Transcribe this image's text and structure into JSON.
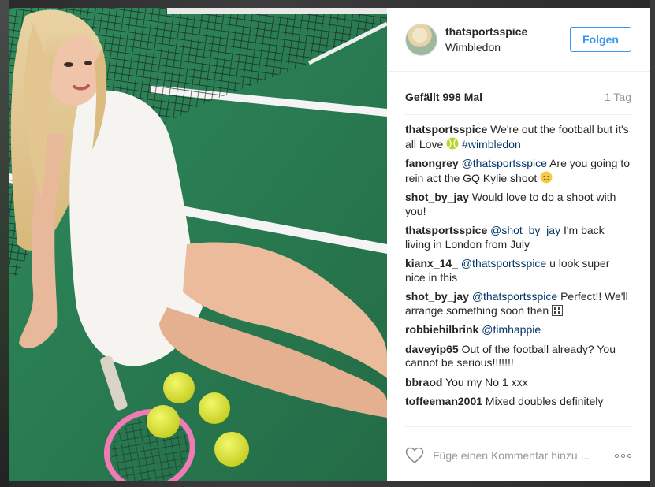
{
  "post": {
    "username": "thatsportsspice",
    "location": "Wimbledon",
    "follow_label": "Folgen",
    "likes": "Gefällt 998 Mal",
    "time": "1 Tag",
    "comment_placeholder": "Füge einen Kommentar hinzu ..."
  },
  "comments": [
    {
      "author": "thatsportsspice",
      "before": " We're out the football but it's all Love ",
      "emoji": "tennis-ball",
      "mention": "",
      "hashtag": "#wimbledon",
      "after": ""
    },
    {
      "author": "fanongrey",
      "before": " ",
      "mention": "@thatsportsspice",
      "after": " Are you going to rein act the GQ Kylie shoot ",
      "emoji_end": "smile"
    },
    {
      "author": "shot_by_jay",
      "before": " Would love to do a shoot with you!",
      "mention": "",
      "after": ""
    },
    {
      "author": "thatsportsspice",
      "before": " ",
      "mention": "@shot_by_jay",
      "after": " I'm back living in London from July"
    },
    {
      "author": "kianx_14_",
      "before": " ",
      "mention": "@thatsportsspice",
      "after": " u look super nice in this"
    },
    {
      "author": "shot_by_jay",
      "before": " ",
      "mention": "@thatsportsspice",
      "after": " Perfect!! We'll arrange something soon then ",
      "emoji_end": "box"
    },
    {
      "author": "robbiehilbrink",
      "before": " ",
      "mention": "@timhappie",
      "after": ""
    },
    {
      "author": "daveyip65",
      "before": " Out of the football already? You cannot be serious!!!!!!!",
      "mention": "",
      "after": ""
    },
    {
      "author": "bbraod",
      "before": " You my No 1 xxx",
      "mention": "",
      "after": ""
    },
    {
      "author": "toffeeman2001",
      "before": " Mixed doubles definitely",
      "mention": "",
      "after": ""
    }
  ],
  "icons": {
    "heart": "heart-outline-icon",
    "more": "more-options-icon"
  },
  "colors": {
    "link": "#003569",
    "follow": "#3897f0",
    "muted": "#999999"
  }
}
